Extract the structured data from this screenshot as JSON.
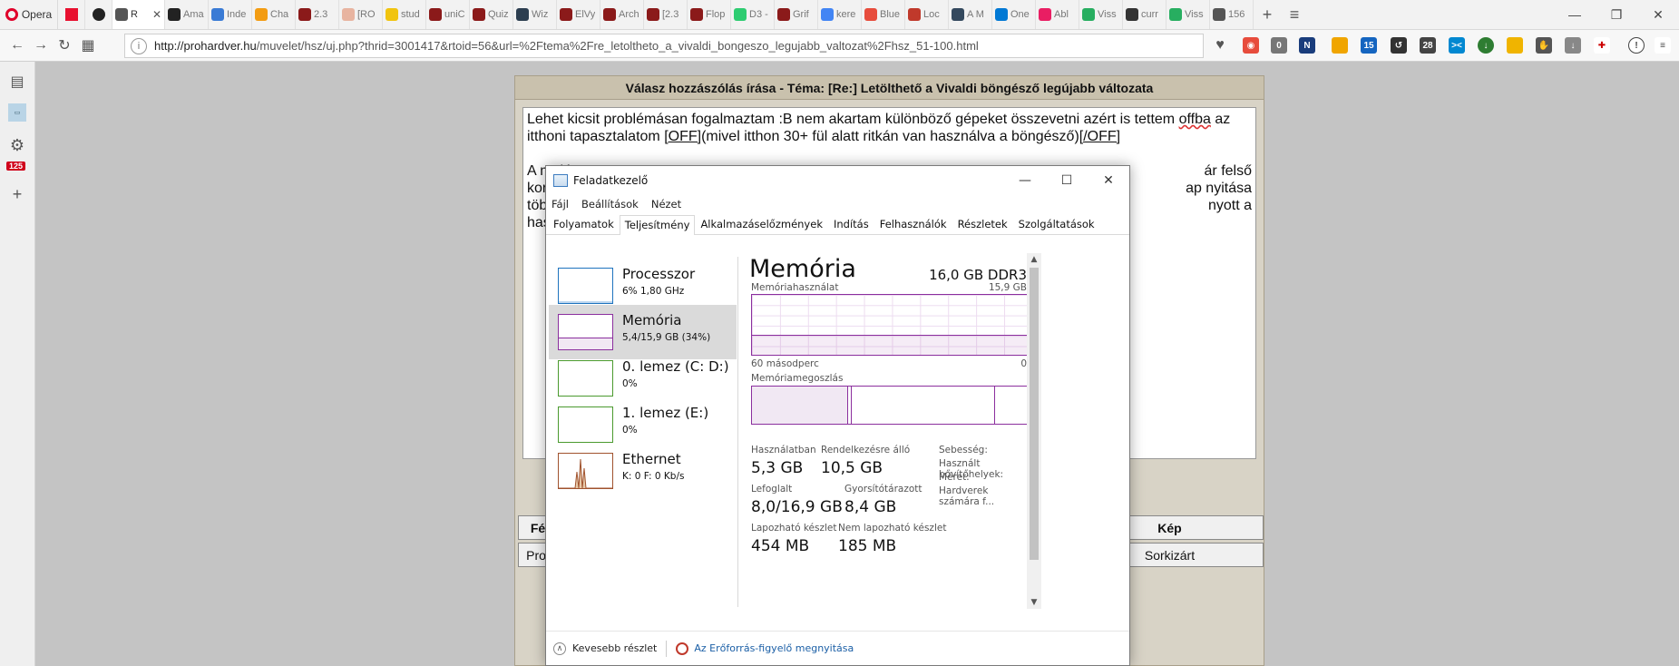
{
  "browser": {
    "opera_label": "Opera",
    "tabs": [
      {
        "label": "R",
        "color": "#555555",
        "active": true
      },
      {
        "label": "Ama",
        "color": "#222222"
      },
      {
        "label": "Inde",
        "color": "#3a7bd5"
      },
      {
        "label": "Cha",
        "color": "#f39c12"
      },
      {
        "label": "2.3",
        "color": "#8b1a1a"
      },
      {
        "label": "[RO",
        "color": "#e8b4a0"
      },
      {
        "label": "stud",
        "color": "#f1c40f"
      },
      {
        "label": "uniC",
        "color": "#8b1a1a"
      },
      {
        "label": "Quiz",
        "color": "#8b1a1a"
      },
      {
        "label": "Wiz",
        "color": "#2c3e50"
      },
      {
        "label": "ElVy",
        "color": "#8b1a1a"
      },
      {
        "label": "Arch",
        "color": "#8b1a1a"
      },
      {
        "label": "[2.3",
        "color": "#8b1a1a"
      },
      {
        "label": "Flop",
        "color": "#8b1a1a"
      },
      {
        "label": "D3 -",
        "color": "#2ecc71"
      },
      {
        "label": "Grif",
        "color": "#8b1a1a"
      },
      {
        "label": "kere",
        "color": "#4285f4"
      },
      {
        "label": "Blue",
        "color": "#e74c3c"
      },
      {
        "label": "Loc",
        "color": "#c0392b"
      },
      {
        "label": "A M",
        "color": "#34495e"
      },
      {
        "label": "One",
        "color": "#0078d4"
      },
      {
        "label": "Abl",
        "color": "#e91e63"
      },
      {
        "label": "Viss",
        "color": "#27ae60"
      },
      {
        "label": "curr",
        "color": "#333333"
      },
      {
        "label": "Viss",
        "color": "#27ae60"
      },
      {
        "label": "156",
        "color": "#555555"
      }
    ],
    "url_domain": "http://prohardver.hu",
    "url_rest": "/muvelet/hsz/uj.php?thrid=3001417&rtoid=56&url=%2Ftema%2Fre_letoltheto_a_vivaldi_bongeszo_legujabb_valtozat%2Fhsz_51-100.html",
    "ext_badges": [
      "0",
      "15",
      "28"
    ],
    "sidebar_badge": "125"
  },
  "forum": {
    "title": "Válasz hozzászólás írása - Téma: [Re:] Letölthető a Vivaldi böngésző legújabb változata",
    "text_p1_a": "Lehet kicsit problémásan fogalmaztam :B nem akartam különböző gépeket összevetni azért is tettem ",
    "text_p1_offba": "offba",
    "text_p1_b": " az itthoni tapasztalatom ",
    "text_p1_off1": "[OFF]",
    "text_p1_c": "(mivel itthon 30+ fül alatt ritkán van használva a böngésző)",
    "text_p1_off2": "[/OFF]",
    "text_p2_line1_left": "A melós",
    "text_p2_line1_right": "ár felső",
    "text_p2_line2_left": "korlát, an",
    "text_p2_line2_right": "ap nyitása",
    "text_p2_line3_left": "több 10 n",
    "text_p2_line3_right": "nyott a",
    "text_p2_line4_left": "használh",
    "btn_felkov": "Félköv",
    "btn_kep": "Kép",
    "btn_program": "Program",
    "btn_sorkizart": "Sorkizárt"
  },
  "taskmanager": {
    "title": "Feladatkezelő",
    "menu": [
      "Fájl",
      "Beállítások",
      "Nézet"
    ],
    "tabs": [
      "Folyamatok",
      "Teljesítmény",
      "Alkalmazáselőzmények",
      "Indítás",
      "Felhasználók",
      "Részletek",
      "Szolgáltatások"
    ],
    "selected_tab": "Teljesítmény",
    "resources": [
      {
        "name": "Processzor",
        "sub": "6% 1,80 GHz",
        "color": "#1e73be"
      },
      {
        "name": "Memória",
        "sub": "5,4/15,9 GB (34%)",
        "color": "#8b2f9e"
      },
      {
        "name": "0. lemez (C: D:)",
        "sub": "0%",
        "color": "#4a9a2e"
      },
      {
        "name": "1. lemez (E:)",
        "sub": "0%",
        "color": "#4a9a2e"
      },
      {
        "name": "Ethernet",
        "sub": "K: 0 F: 0 Kb/s",
        "color": "#a0522d"
      }
    ],
    "memory": {
      "heading": "Memória",
      "spec": "16,0 GB DDR3",
      "usage_caption": "Memóriahasználat",
      "usage_max": "15,9 GB",
      "time_caption": "60 másodperc",
      "time_zero": "0",
      "usage_fraction": 0.34,
      "composition_caption": "Memóriamegoszlás",
      "stats": {
        "in_use_label": "Használatban",
        "in_use": "5,3 GB",
        "available_label": "Rendelkezésre álló",
        "available": "10,5 GB",
        "committed_label": "Lefoglalt",
        "committed": "8,0/16,9 GB",
        "cached_label": "Gyorsítótárazott",
        "cached": "8,4 GB",
        "paged_label": "Lapozható készlet",
        "paged": "454 MB",
        "nonpaged_label": "Nem lapozható készlet",
        "nonpaged": "185 MB",
        "speed_label": "Sebesség:",
        "slots_label": "Használt bővítőhelyek:",
        "form_label": "Méret:",
        "reserved_label": "Hardverek számára f..."
      }
    },
    "footer": {
      "fewer_details": "Kevesebb részlet",
      "resource_monitor": "Az Erőforrás-figyelő megnyitása"
    }
  }
}
